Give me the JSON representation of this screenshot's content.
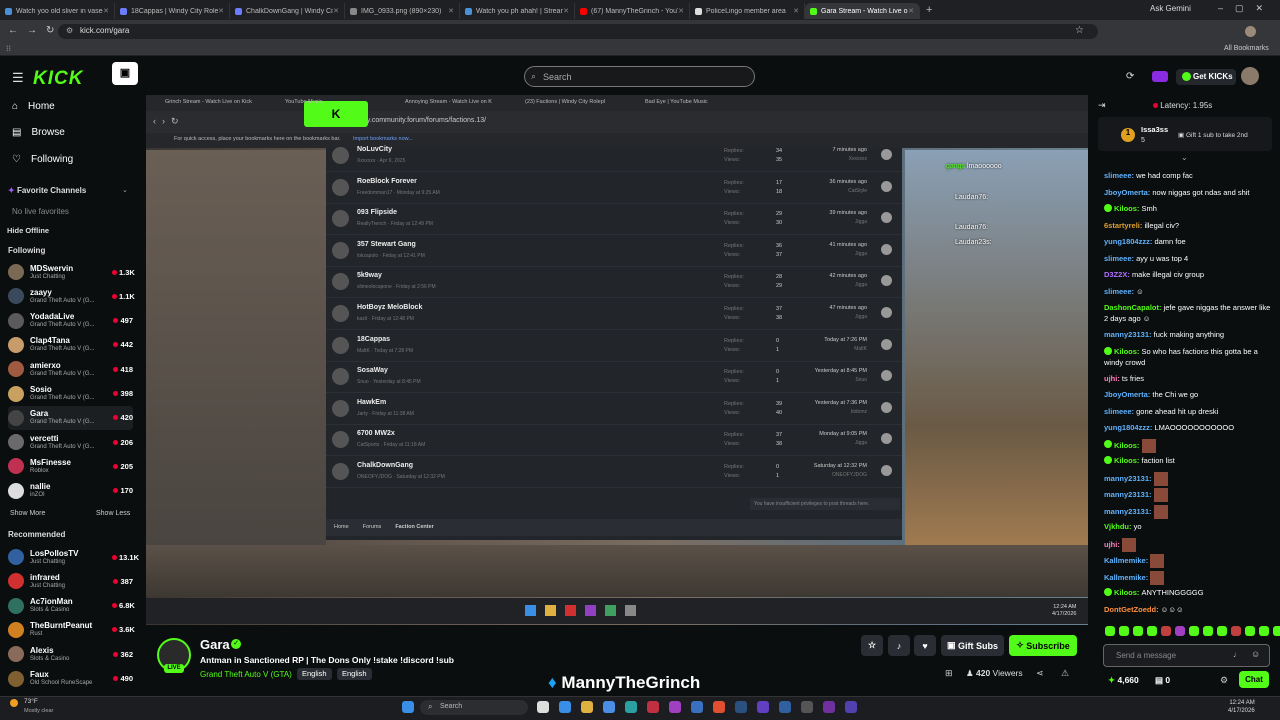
{
  "browser": {
    "tabs": [
      {
        "label": "Watch yoo old sliver in vaseo",
        "color": "#4a90d9"
      },
      {
        "label": "18Cappas | Windy City Roleplay",
        "color": "#6b7cff"
      },
      {
        "label": "ChalkDownGang | Windy City",
        "color": "#6b7cff"
      },
      {
        "label": "IMG_0933.png (890×230)",
        "color": "#888888"
      },
      {
        "label": "Watch you ph ahah! | Streamer",
        "color": "#4a90d9"
      },
      {
        "label": "(67) MannyTheGrinch - YouTube",
        "color": "#ff0000"
      },
      {
        "label": "PoliceLingo member area",
        "color": "#dddddd"
      },
      {
        "label": "Gara Stream - Watch Live o...",
        "color": "#53fc18",
        "active": true
      }
    ],
    "url": "kick.com/gara",
    "ask_gemini": "Ask Gemini",
    "all_bookmarks": "All Bookmarks"
  },
  "kick": {
    "logo": "KICK",
    "search_placeholder": "Search",
    "get_kicks": "Get KICKs"
  },
  "sidebar": {
    "home": "Home",
    "browse": "Browse",
    "following": "Following",
    "favorite_channels": "Favorite Channels",
    "no_live_favorites": "No live favorites",
    "hide_offline": "Hide Offline",
    "following_header": "Following",
    "show_more": "Show More",
    "show_less": "Show Less",
    "recommended_header": "Recommended",
    "following_channels": [
      {
        "name": "MDSwervin",
        "game": "Just Chatting",
        "viewers": "1.3K",
        "color": "#7a6a55"
      },
      {
        "name": "zaayy",
        "game": "Grand Theft Auto V (G...",
        "viewers": "1.1K",
        "color": "#3a4a5c"
      },
      {
        "name": "YodadaLive",
        "game": "Grand Theft Auto V (G...",
        "viewers": "497",
        "color": "#5a5a5a"
      },
      {
        "name": "Clap4Tana",
        "game": "Grand Theft Auto V (G...",
        "viewers": "442",
        "color": "#c89b6a"
      },
      {
        "name": "amierxo",
        "game": "Grand Theft Auto V (G...",
        "viewers": "418",
        "color": "#a05a40"
      },
      {
        "name": "Sosio",
        "game": "Grand Theft Auto V (G...",
        "viewers": "398",
        "color": "#c8a060"
      },
      {
        "name": "Gara",
        "game": "Grand Theft Auto V (G...",
        "viewers": "420",
        "color": "#444444"
      },
      {
        "name": "vercetti",
        "game": "Grand Theft Auto V (G...",
        "viewers": "206",
        "color": "#6a6a6a"
      },
      {
        "name": "MsFinesse",
        "game": "Roblox",
        "viewers": "205",
        "color": "#c03050"
      },
      {
        "name": "nallie",
        "game": "inZOI",
        "viewers": "170",
        "color": "#dddddd"
      }
    ],
    "recommended_channels": [
      {
        "name": "LosPollosTV",
        "game": "Just Chatting",
        "viewers": "13.1K",
        "color": "#3060a0"
      },
      {
        "name": "infrared",
        "game": "Just Chatting",
        "viewers": "387",
        "color": "#d03030"
      },
      {
        "name": "Ac7ionMan",
        "game": "Slots & Casino",
        "viewers": "6.8K",
        "color": "#307060"
      },
      {
        "name": "TheBurntPeanut",
        "game": "Rust",
        "viewers": "3.6K",
        "color": "#d08020"
      },
      {
        "name": "Alexis",
        "game": "Slots & Casino",
        "viewers": "362",
        "color": "#8a6a5a"
      },
      {
        "name": "Faux",
        "game": "Old School RuneScape",
        "viewers": "490",
        "color": "#806030"
      }
    ]
  },
  "stream": {
    "inner_tabs": [
      "Grinch Stream - Watch Live on Kick",
      "YouTube Music",
      "Annoying Stream - Watch Live on K",
      "(23) Factions | Windy City Rolepl",
      "Bad Eye | YouTube Music"
    ],
    "inner_url": "windycity.community.forum/forums/factions.13/",
    "inner_bookmark_hint": "For quick access, place your bookmarks here on the bookmarks bar.",
    "inner_import": "Import bookmarks now...",
    "forum_rows": [
      {
        "title": "NoLuvCity",
        "sub": "Xxxxxxx · Apr 9, 2025",
        "replies": "34",
        "views": "35",
        "last": "7 minutes ago",
        "user": "Xxxxxxx"
      },
      {
        "title": "RoeBlock Forever",
        "sub": "Freedomman17 · Monday at 9:25 AM",
        "replies": "17",
        "views": "18",
        "last": "36 minutes ago",
        "user": "CatStyle"
      },
      {
        "title": "093 Flipside",
        "sub": "ReallyTrench · Friday at 12:49 PM",
        "replies": "29",
        "views": "30",
        "last": "39 minutes ago",
        "user": "Jigga"
      },
      {
        "title": "357 Stewart Gang",
        "sub": "lokzapolo · Friday at 12:41 PM",
        "replies": "36",
        "views": "37",
        "last": "41 minutes ago",
        "user": "Jigga"
      },
      {
        "title": "5k9way",
        "sub": "slimeolocapone · Friday at 2:56 PM",
        "replies": "28",
        "views": "29",
        "last": "42 minutes ago",
        "user": "Jigga"
      },
      {
        "title": "HotBoyz MeloBlock",
        "sub": "kaziI · Friday at 12:48 PM",
        "replies": "37",
        "views": "38",
        "last": "47 minutes ago",
        "user": "Jigga"
      },
      {
        "title": "18Cappas",
        "sub": "MaltK · Today at 7:28 PM",
        "replies": "0",
        "views": "1",
        "last": "Today at 7:26 PM",
        "user": "MaltK"
      },
      {
        "title": "SosaWay",
        "sub": "Snuo · Yesterday at 8:45 PM",
        "replies": "0",
        "views": "1",
        "last": "Yesterday at 8:45 PM",
        "user": "Snuo"
      },
      {
        "title": "HawkEm",
        "sub": "Jarty · Friday at 11:38 AM",
        "replies": "39",
        "views": "40",
        "last": "Yesterday at 7:36 PM",
        "user": "ktdomz"
      },
      {
        "title": "6700 MW2x",
        "sub": "CatSports · Friday at 11:18 AM",
        "replies": "37",
        "views": "38",
        "last": "Monday at 9:05 PM",
        "user": "Jigga"
      },
      {
        "title": "ChalkDownGang",
        "sub": "ONEOFYJDOG · Saturday at 12:32 PM",
        "replies": "0",
        "views": "1",
        "last": "Saturday at 12:32 PM",
        "user": "ONEOFYJDOG"
      }
    ],
    "replies_label": "Replies:",
    "views_label": "Views:",
    "no_privileges": "You have insufficient privileges to post threads here.",
    "breadcrumb": [
      "Home",
      "Forums",
      "Faction Center"
    ],
    "inner_time": "12:24 AM",
    "inner_date": "4/17/2026",
    "overlay_chat": [
      {
        "user": "gangs",
        "text": "lmaoooooo"
      },
      {
        "user": "Laudan76:",
        "text": ""
      },
      {
        "user": "Laudan76:",
        "text": ""
      },
      {
        "user": "Laudan23s:",
        "text": ""
      }
    ]
  },
  "channel": {
    "name": "Gara",
    "live": "LIVE",
    "title": "Antman in Sanctioned RP | The Dons Only !stake !discord !sub",
    "category": "Grand Theft Auto V (GTA)",
    "tags": [
      "English",
      "English"
    ],
    "gift_subs": "Gift Subs",
    "subscribe": "Subscribe",
    "viewers": "420",
    "viewers_label": "Viewers",
    "twitter_handle": "MannyTheGrinch"
  },
  "chat": {
    "latency": "Latency: 1.95s",
    "gift_user": "Issa3ss",
    "gift_count": "5",
    "gift_text": "Gift 1 sub to take 2nd",
    "messages": [
      {
        "user": "slimeee:",
        "text": "we had comp fac",
        "color": "#5fb3ff"
      },
      {
        "user": "JboyOmerta:",
        "text": "now niggas got ndas and shit",
        "color": "#5fb3ff"
      },
      {
        "user": "Kiloos:",
        "text": "Smh",
        "color": "#53fc18",
        "verified": true
      },
      {
        "user": "6startyreli:",
        "text": "illegal civ?",
        "color": "#e0a030"
      },
      {
        "user": "yung1804zzz:",
        "text": "damn foe",
        "color": "#5fb3ff"
      },
      {
        "user": "slimeee:",
        "text": "ayy u was top 4",
        "color": "#5fb3ff"
      },
      {
        "user": "D3Z2X:",
        "text": "make illegal civ group",
        "color": "#b070ff"
      },
      {
        "user": "slimeee:",
        "text": "☺",
        "color": "#5fb3ff"
      },
      {
        "user": "DashonCapalot:",
        "text": "jefe gave niggas the answer like 2 days ago ☺",
        "color": "#53fc18"
      },
      {
        "user": "manny23131:",
        "text": "fuck making anything",
        "color": "#5fb3ff"
      },
      {
        "user": "Kiloos:",
        "text": "So who has factions this gotta be a windy crowd",
        "color": "#53fc18",
        "verified": true
      },
      {
        "user": "ujhi:",
        "text": "ts fries",
        "color": "#ff80c0"
      },
      {
        "user": "JboyOmerta:",
        "text": "the Chi we go",
        "color": "#5fb3ff"
      },
      {
        "user": "slimeee:",
        "text": "gone ahead hit up dreski",
        "color": "#5fb3ff"
      },
      {
        "user": "yung1804zzz:",
        "text": "LMAOOOOOOOOOOO",
        "color": "#5fb3ff"
      },
      {
        "user": "Kiloos:",
        "text": "",
        "color": "#53fc18",
        "verified": true,
        "emote": true
      },
      {
        "user": "Kiloos:",
        "text": "faction list",
        "color": "#53fc18",
        "verified": true
      },
      {
        "user": "manny23131:",
        "text": "",
        "color": "#5fb3ff",
        "emote": true
      },
      {
        "user": "manny23131:",
        "text": "",
        "color": "#5fb3ff",
        "emote": true
      },
      {
        "user": "manny23131:",
        "text": "",
        "color": "#5fb3ff",
        "emote": true
      },
      {
        "user": "Vjkhdu:",
        "text": "yo",
        "color": "#53fc18"
      },
      {
        "user": "ujhi:",
        "text": "",
        "color": "#ff80c0",
        "emote": true
      },
      {
        "user": "Kallmemike:",
        "text": "",
        "color": "#5fb3ff",
        "emote": true
      },
      {
        "user": "Kallmemike:",
        "text": "",
        "color": "#5fb3ff",
        "emote": true
      },
      {
        "user": "Kiloos:",
        "text": "ANYTHINGGGGG",
        "color": "#53fc18",
        "verified": true
      },
      {
        "user": "DontGetZoedd:",
        "text": "☺☺☺",
        "color": "#ff9040"
      }
    ],
    "input_placeholder": "Send a message",
    "points": "4,660",
    "zero": "0",
    "chat_button": "Chat"
  },
  "os": {
    "weather_temp": "73°F",
    "weather_text": "Mostly clear",
    "search": "Search",
    "time": "12:24 AM",
    "date": "4/17/2026"
  }
}
